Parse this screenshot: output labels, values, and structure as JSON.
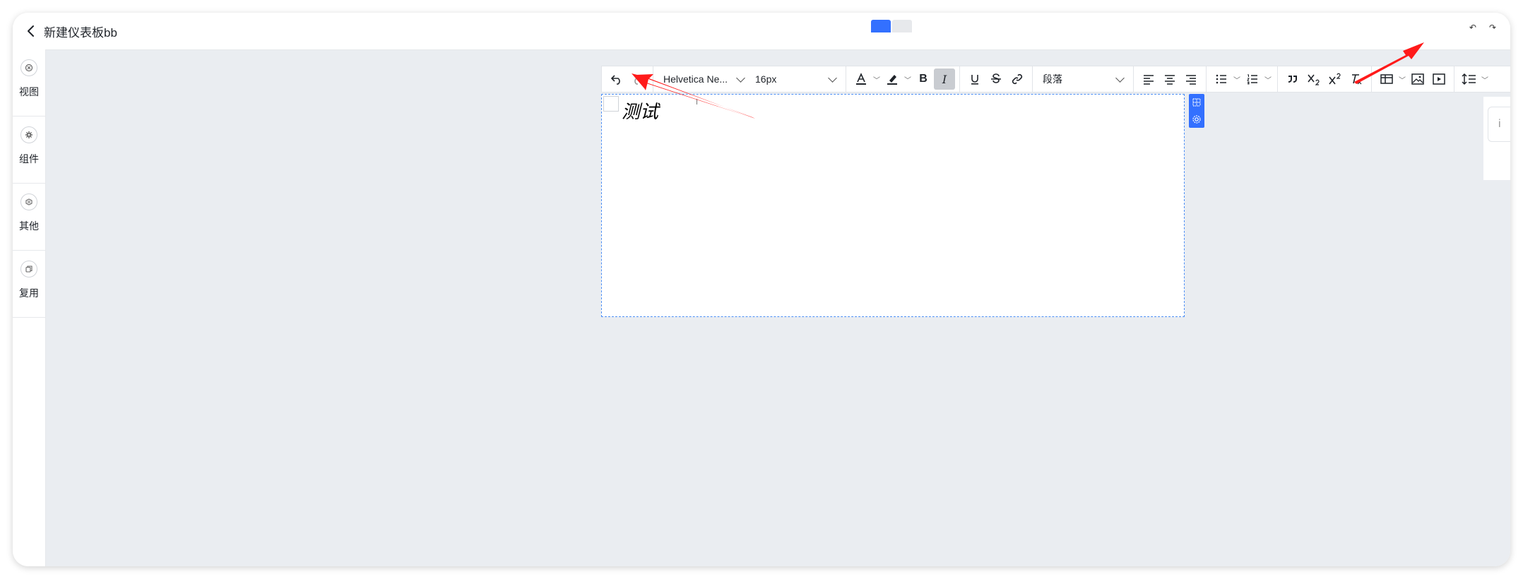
{
  "header": {
    "title": "新建仪表板bb"
  },
  "sidebar": {
    "items": [
      {
        "label": "视图",
        "icon": "view-icon"
      },
      {
        "label": "组件",
        "icon": "component-icon"
      },
      {
        "label": "其他",
        "icon": "other-icon"
      },
      {
        "label": "复用",
        "icon": "reuse-icon"
      }
    ]
  },
  "toolbar": {
    "font_family": "Helvetica Ne...",
    "font_size": "16px",
    "block_format": "段落",
    "bold": "B",
    "italic": "I",
    "italic_active": true
  },
  "editor": {
    "content": "测试"
  },
  "right_panel": {
    "partial_text": "i"
  },
  "annotations": {
    "arrow_color": "#ff1a1a"
  },
  "colors": {
    "accent": "#3370ff",
    "canvas_bg": "#eaedf1"
  }
}
